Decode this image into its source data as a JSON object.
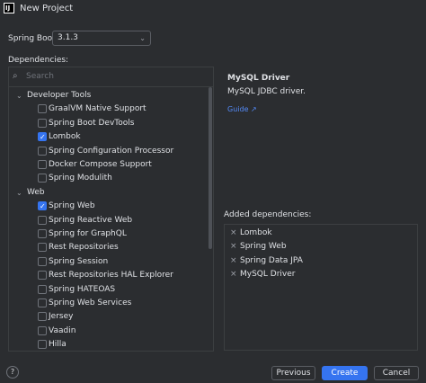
{
  "window": {
    "title": "New Project",
    "app_icon_text": "IJ"
  },
  "spring_boot": {
    "label": "Spring Boot:",
    "value": "3.1.3"
  },
  "dependencies_label": "Dependencies:",
  "search": {
    "placeholder": "Search"
  },
  "tree": [
    {
      "type": "group",
      "label": "Developer Tools",
      "expanded": true
    },
    {
      "type": "item",
      "label": "GraalVM Native Support",
      "checked": false
    },
    {
      "type": "item",
      "label": "Spring Boot DevTools",
      "checked": false
    },
    {
      "type": "item",
      "label": "Lombok",
      "checked": true
    },
    {
      "type": "item",
      "label": "Spring Configuration Processor",
      "checked": false
    },
    {
      "type": "item",
      "label": "Docker Compose Support",
      "checked": false
    },
    {
      "type": "item",
      "label": "Spring Modulith",
      "checked": false
    },
    {
      "type": "group",
      "label": "Web",
      "expanded": true
    },
    {
      "type": "item",
      "label": "Spring Web",
      "checked": true
    },
    {
      "type": "item",
      "label": "Spring Reactive Web",
      "checked": false
    },
    {
      "type": "item",
      "label": "Spring for GraphQL",
      "checked": false
    },
    {
      "type": "item",
      "label": "Rest Repositories",
      "checked": false
    },
    {
      "type": "item",
      "label": "Spring Session",
      "checked": false
    },
    {
      "type": "item",
      "label": "Rest Repositories HAL Explorer",
      "checked": false
    },
    {
      "type": "item",
      "label": "Spring HATEOAS",
      "checked": false
    },
    {
      "type": "item",
      "label": "Spring Web Services",
      "checked": false
    },
    {
      "type": "item",
      "label": "Jersey",
      "checked": false
    },
    {
      "type": "item",
      "label": "Vaadin",
      "checked": false
    },
    {
      "type": "item",
      "label": "Hilla",
      "checked": false
    }
  ],
  "detail": {
    "name": "MySQL Driver",
    "description": "MySQL JDBC driver.",
    "guide_label": "Guide ↗"
  },
  "added": {
    "label": "Added dependencies:",
    "items": [
      "Lombok",
      "Spring Web",
      "Spring Data JPA",
      "MySQL Driver"
    ]
  },
  "buttons": {
    "help": "?",
    "previous": "Previous",
    "create": "Create",
    "cancel": "Cancel"
  },
  "colors": {
    "background": "#2b2d30",
    "accent": "#3574f0",
    "link": "#548af7"
  }
}
